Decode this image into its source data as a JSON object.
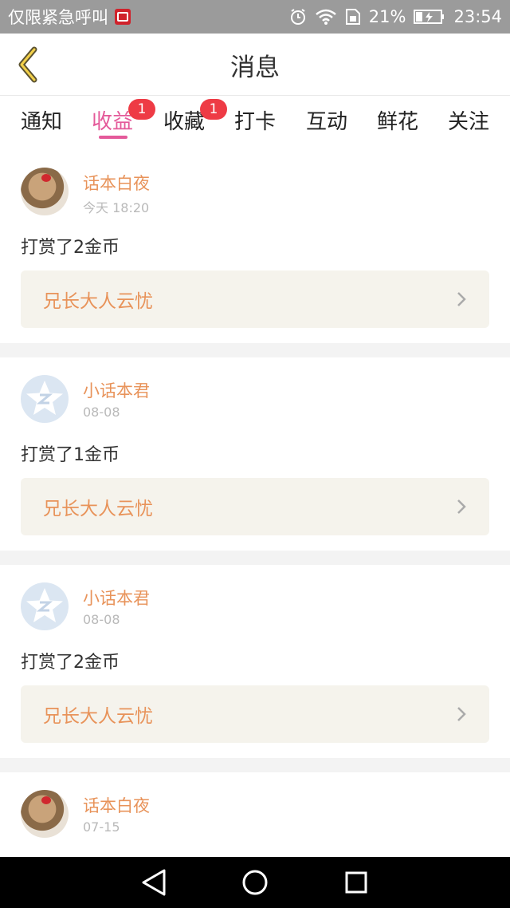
{
  "status_bar": {
    "carrier_text": "仅限紧急呼叫",
    "battery_percent": "21%",
    "time": "23:54"
  },
  "header": {
    "title": "消息",
    "back_icon": "chevron-left-icon"
  },
  "tabs": [
    {
      "label": "通知",
      "active": false,
      "badge": ""
    },
    {
      "label": "收益",
      "active": true,
      "badge": "1"
    },
    {
      "label": "收藏",
      "active": false,
      "badge": "1"
    },
    {
      "label": "打卡",
      "active": false,
      "badge": ""
    },
    {
      "label": "互动",
      "active": false,
      "badge": ""
    },
    {
      "label": "鲜花",
      "active": false,
      "badge": ""
    },
    {
      "label": "关注",
      "active": false,
      "badge": ""
    }
  ],
  "feed": [
    {
      "username": "话本白夜",
      "time": "今天 18:20",
      "message": "打赏了2金币",
      "link": "兄长大人云忧",
      "avatar": "photo"
    },
    {
      "username": "小话本君",
      "time": "08-08",
      "message": "打赏了1金币",
      "link": "兄长大人云忧",
      "avatar": "default"
    },
    {
      "username": "小话本君",
      "time": "08-08",
      "message": "打赏了2金币",
      "link": "兄长大人云忧",
      "avatar": "default"
    },
    {
      "username": "话本白夜",
      "time": "07-15",
      "message": "",
      "link": "",
      "avatar": "photo"
    }
  ],
  "colors": {
    "accent": "#e45a9a",
    "username": "#e8935a",
    "badge": "#ee3b45",
    "link_bg": "#f5f3ec"
  }
}
